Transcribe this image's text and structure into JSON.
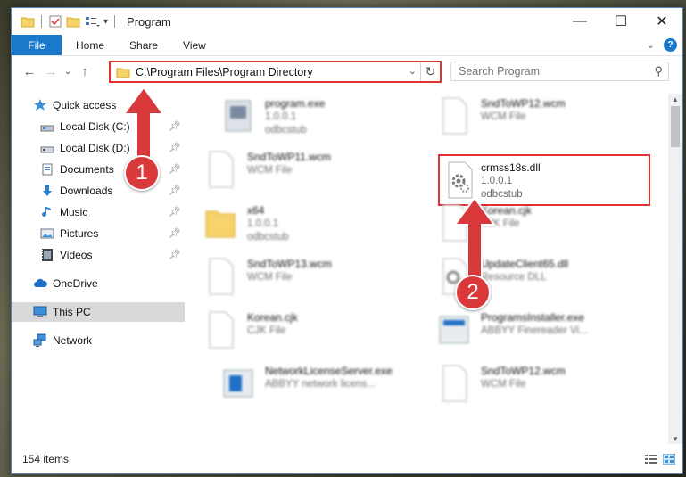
{
  "window": {
    "title": "Program",
    "controls": {
      "minimize": "—",
      "maximize": "☐",
      "close": "✕"
    }
  },
  "ribbon": {
    "file_tab": "File",
    "tabs": [
      "Home",
      "Share",
      "View"
    ]
  },
  "address": {
    "path": "C:\\Program Files\\Program Directory",
    "search_placeholder": "Search Program"
  },
  "nav": {
    "items": [
      {
        "label": "Quick access",
        "icon": "star-icon"
      },
      {
        "label": "Local Disk (C:)",
        "icon": "drive-icon",
        "pinned": true
      },
      {
        "label": "Local Disk (D:)",
        "icon": "drive-icon",
        "pinned": true
      },
      {
        "label": "Documents",
        "icon": "documents-icon",
        "pinned": true
      },
      {
        "label": "Downloads",
        "icon": "download-icon",
        "pinned": true
      },
      {
        "label": "Music",
        "icon": "music-icon",
        "pinned": true
      },
      {
        "label": "Pictures",
        "icon": "pictures-icon",
        "pinned": true
      },
      {
        "label": "Videos",
        "icon": "videos-icon",
        "pinned": true
      },
      {
        "label": "OneDrive",
        "icon": "cloud-icon"
      },
      {
        "label": "This PC",
        "icon": "computer-icon",
        "selected": true
      },
      {
        "label": "Network",
        "icon": "network-icon"
      }
    ]
  },
  "files": {
    "col1": [
      {
        "name": "program.exe",
        "line2": "1.0.0.1",
        "line3": "odbcstub"
      },
      {
        "name": "SndToWP11.wcm",
        "line2": "WCM File",
        "line3": ""
      },
      {
        "name": "x64",
        "line2": "1.0.0.1",
        "line3": "odbcstub"
      },
      {
        "name": "SndToWP13.wcm",
        "line2": "WCM File",
        "line3": ""
      },
      {
        "name": "Korean.cjk",
        "line2": "CJK File",
        "line3": ""
      },
      {
        "name": "NetworkLicenseServer.exe",
        "line2": "ABBYY network licens...",
        "line3": ""
      }
    ],
    "col2": [
      {
        "name": "SndToWP12.wcm",
        "line2": "WCM File",
        "line3": ""
      },
      {
        "name": "crmss18s.dll",
        "line2": "1.0.0.1",
        "line3": "odbcstub"
      },
      {
        "name": "Korean.cjk",
        "line2": "CJK File",
        "line3": ""
      },
      {
        "name": "UpdateClient65.dll",
        "line2": "Resource DLL",
        "line3": ""
      },
      {
        "name": "ProgramsInstaller.exe",
        "line2": "ABBYY Finereader Vi...",
        "line3": ""
      },
      {
        "name": "SndToWP12.wcm",
        "line2": "WCM File",
        "line3": ""
      }
    ]
  },
  "status": {
    "count": "154 items"
  },
  "annotations": {
    "step1": "1",
    "step2": "2",
    "color": "#d9393b"
  }
}
